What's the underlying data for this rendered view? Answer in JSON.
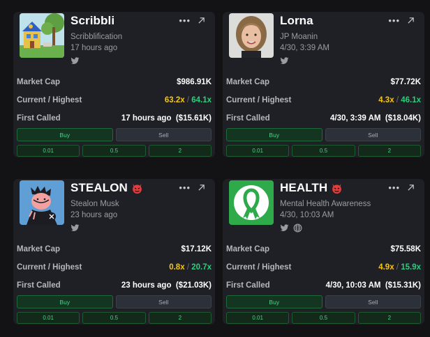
{
  "cards": [
    {
      "name": "Scribbli",
      "subtitle": "Scribblification",
      "time": "17 hours ago",
      "market_cap_label": "Market Cap",
      "market_cap": "$986.91K",
      "ratio_label": "Current / Highest",
      "current": "63.2x",
      "highest": "64.1x",
      "first_called_label": "First Called",
      "first_called": "17 hours ago  ($15.61K)",
      "buy_label": "Buy",
      "sell_label": "Sell",
      "amounts": [
        "0.01",
        "0.5",
        "2"
      ]
    },
    {
      "name": "Lorna",
      "subtitle": "JP Moanin",
      "time": "4/30, 3:39 AM",
      "market_cap_label": "Market Cap",
      "market_cap": "$77.72K",
      "ratio_label": "Current / Highest",
      "current": "4.3x",
      "highest": "46.1x",
      "first_called_label": "First Called",
      "first_called": "4/30, 3:39 AM  ($18.04K)",
      "buy_label": "Buy",
      "sell_label": "Sell",
      "amounts": [
        "0.01",
        "0.5",
        "2"
      ]
    },
    {
      "name": "STEALON",
      "subtitle": "Stealon Musk",
      "time": "23 hours ago",
      "market_cap_label": "Market Cap",
      "market_cap": "$17.12K",
      "ratio_label": "Current / Highest",
      "current": "0.8x",
      "highest": "20.7x",
      "first_called_label": "First Called",
      "first_called": "23 hours ago  ($21.03K)",
      "buy_label": "Buy",
      "sell_label": "Sell",
      "amounts": [
        "0.01",
        "0.5",
        "2"
      ]
    },
    {
      "name": "HEALTH",
      "subtitle": "Mental Health Awareness",
      "time": "4/30, 10:03 AM",
      "market_cap_label": "Market Cap",
      "market_cap": "$75.58K",
      "ratio_label": "Current / Highest",
      "current": "4.9x",
      "highest": "15.9x",
      "first_called_label": "First Called",
      "first_called": "4/30, 10:03 AM  ($15.31K)",
      "buy_label": "Buy",
      "sell_label": "Sell",
      "amounts": [
        "0.01",
        "0.5",
        "2"
      ]
    }
  ],
  "separator": "/",
  "colors": {
    "background": "#131316",
    "card": "#1f2026",
    "current": "#f5c518",
    "highest": "#27d07a",
    "buy": "#4fd18a"
  },
  "icons": {
    "more": "more-icon",
    "open": "open-external-icon",
    "twitter": "twitter-icon",
    "website": "globe-icon",
    "flag": "devil-icon"
  }
}
